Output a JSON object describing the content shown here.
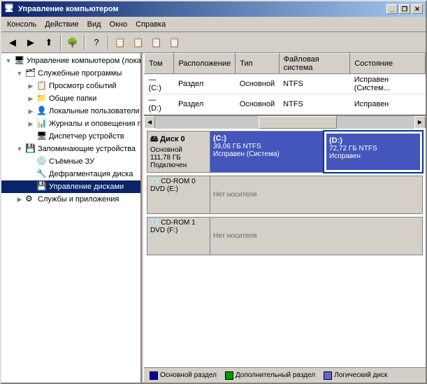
{
  "window": {
    "title": "Управление компьютером",
    "titleIcon": "🖥"
  },
  "titleButtons": {
    "minimize": "_",
    "restore": "❐",
    "close": "✕"
  },
  "menuBar": {
    "items": [
      {
        "label": "Консоль"
      },
      {
        "label": "Действие"
      },
      {
        "label": "Вид"
      },
      {
        "label": "Окно"
      },
      {
        "label": "Справка"
      }
    ]
  },
  "toolbar": {
    "buttons": [
      "←",
      "→",
      "⬆",
      "📋",
      "?",
      "🔍",
      "📄",
      "📁"
    ]
  },
  "tree": {
    "items": [
      {
        "label": "Управление компьютером (локал...",
        "level": 0,
        "expand": "▼",
        "icon": "🖥"
      },
      {
        "label": "Служебные программы",
        "level": 1,
        "expand": "▼",
        "icon": "🗂"
      },
      {
        "label": "Просмотр событий",
        "level": 2,
        "expand": "▶",
        "icon": "📋"
      },
      {
        "label": "Общие папки",
        "level": 2,
        "expand": "▶",
        "icon": "📁"
      },
      {
        "label": "Локальные пользователи",
        "level": 2,
        "expand": "▶",
        "icon": "👤"
      },
      {
        "label": "Журналы и оповещения пр...",
        "level": 2,
        "expand": "▶",
        "icon": "📊"
      },
      {
        "label": "Диспетчер устройств",
        "level": 2,
        "expand": "",
        "icon": "🖥"
      },
      {
        "label": "Запоминающие устройства",
        "level": 1,
        "expand": "▼",
        "icon": "💾"
      },
      {
        "label": "Съёмные ЗУ",
        "level": 2,
        "expand": "",
        "icon": "💿"
      },
      {
        "label": "Дефрагментация диска",
        "level": 2,
        "expand": "",
        "icon": "🔧"
      },
      {
        "label": "Управление дисками",
        "level": 2,
        "expand": "",
        "icon": "💾",
        "selected": true
      },
      {
        "label": "Службы и приложения",
        "level": 1,
        "expand": "▶",
        "icon": "⚙"
      }
    ]
  },
  "tableHeaders": [
    "Том",
    "Расположение",
    "Тип",
    "Файловая система",
    "Состояние"
  ],
  "tableRows": [
    {
      "tom": "(C:)",
      "location": "Раздел",
      "type": "Основной",
      "fs": "NTFS",
      "status": "Исправен (Систем..."
    },
    {
      "tom": "(D:)",
      "location": "Раздел",
      "type": "Основной",
      "fs": "NTFS",
      "status": "Исправен"
    }
  ],
  "disks": [
    {
      "name": "Диск 0",
      "type": "Основной",
      "size": "111,78 ГБ",
      "status": "Подключен",
      "partitions": [
        {
          "label": "(C:)",
          "size": "39,06 ГБ NTFS",
          "status": "Исправен (Система)",
          "width": 55,
          "style": "primary"
        },
        {
          "label": "(D:)",
          "size": "72,72 ГБ NTFS",
          "status": "Исправен",
          "width": 45,
          "style": "primary-selected"
        }
      ]
    }
  ],
  "cdroms": [
    {
      "name": "CD-ROM 0",
      "type": "DVD (E:)",
      "noMedia": "Нет носителя"
    },
    {
      "name": "CD-ROM 1",
      "type": "DVD (F:)",
      "noMedia": "Нет носителя"
    }
  ],
  "legend": [
    {
      "color": "#0000aa",
      "label": "Основной раздел"
    },
    {
      "color": "#009900",
      "label": "Дополнительный раздел"
    },
    {
      "color": "#6666cc",
      "label": "Логический диск"
    }
  ]
}
